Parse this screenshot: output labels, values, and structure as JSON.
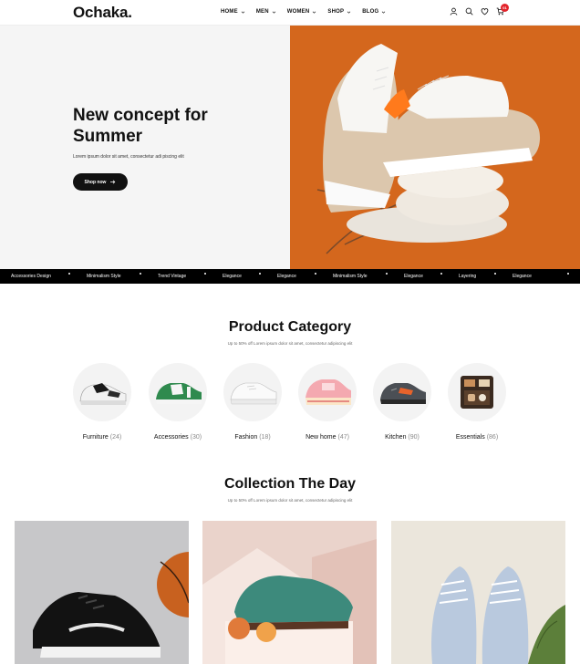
{
  "brand": {
    "logo": "Ochaka."
  },
  "nav": {
    "items": [
      {
        "label": "HOME"
      },
      {
        "label": "MEN"
      },
      {
        "label": "WOMEN"
      },
      {
        "label": "SHOP"
      },
      {
        "label": "BLOG"
      }
    ]
  },
  "header_icons": [
    "user-icon",
    "search-icon",
    "heart-icon",
    "cart-icon"
  ],
  "cart": {
    "count": "01"
  },
  "hero": {
    "title_line1": "New concept for",
    "title_line2": "Summer",
    "subtitle": "Lorem ipsum dolor sit amet, consectetur adi piscing elit",
    "button_label": "Shop now",
    "bg_color": "#d96a1f"
  },
  "ticker": {
    "items": [
      "Accessories Design",
      "Minimalism Style",
      "Trend Vintage",
      "Elegance",
      "Elegance",
      "Minimalism Style",
      "Elegance",
      "Layering",
      "Elegance"
    ]
  },
  "categories_section": {
    "title": "Product Category",
    "subtitle": "Up to 50% off Lorem ipsum dolor sit amet, consectetur adipiscing elit",
    "items": [
      {
        "name": "Furniture",
        "count": "(24)"
      },
      {
        "name": "Accessories",
        "count": "(30)"
      },
      {
        "name": "Fashion",
        "count": "(18)"
      },
      {
        "name": "New home",
        "count": "(47)"
      },
      {
        "name": "Kitchen",
        "count": "(90)"
      },
      {
        "name": "Essentials",
        "count": "(86)"
      }
    ]
  },
  "collection_section": {
    "title": "Collection The Day",
    "subtitle": "Up to 50% off Lorem ipsum dolor sit amet, consectetur adipiscing elit"
  }
}
